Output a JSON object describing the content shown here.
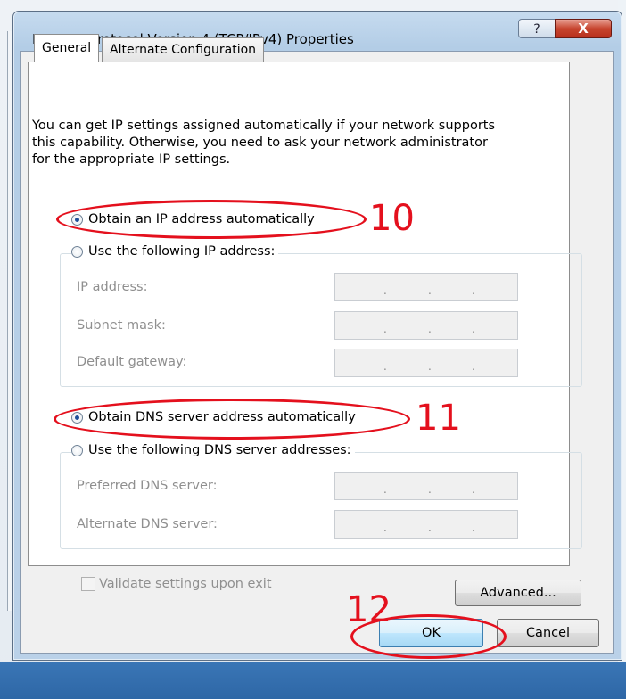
{
  "dialog": {
    "title": "Internet Protocol Version 4 (TCP/IPv4) Properties",
    "help_label": "?",
    "close_label": "X"
  },
  "tabs": [
    {
      "label": "General",
      "selected": true
    },
    {
      "label": "Alternate Configuration",
      "selected": false
    }
  ],
  "description": [
    "You can get IP settings assigned automatically if your network supports",
    "this capability. Otherwise, you need to ask your network administrator",
    "for the appropriate IP settings."
  ],
  "ip": {
    "auto_label": "Obtain an IP address automatically",
    "auto_selected": true,
    "manual_label": "Use the following IP address:",
    "fields": [
      {
        "label": "IP address:",
        "value": ""
      },
      {
        "label": "Subnet mask:",
        "value": ""
      },
      {
        "label": "Default gateway:",
        "value": ""
      }
    ]
  },
  "dns": {
    "auto_label": "Obtain DNS server address automatically",
    "auto_selected": true,
    "manual_label": "Use the following DNS server addresses:",
    "fields": [
      {
        "label": "Preferred DNS server:",
        "value": ""
      },
      {
        "label": "Alternate DNS server:",
        "value": ""
      }
    ]
  },
  "validate_label": "Validate settings upon exit",
  "buttons": {
    "advanced": "Advanced...",
    "ok": "OK",
    "cancel": "Cancel"
  },
  "annotations": {
    "step1": "10",
    "step2": "11",
    "step3": "12",
    "color": "#e4101d"
  },
  "ip_dot": "."
}
